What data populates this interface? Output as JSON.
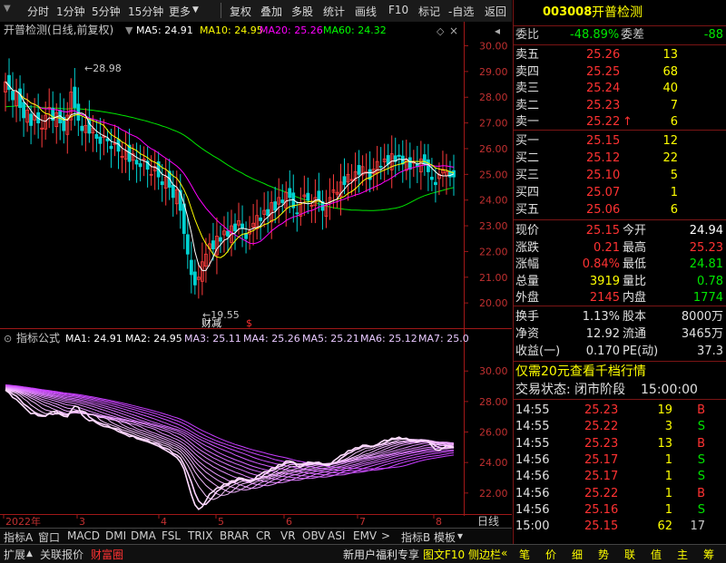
{
  "toolbar": {
    "items": [
      "分时",
      "1分钟",
      "5分钟",
      "15分钟",
      "更多",
      "复权",
      "叠加",
      "多股",
      "统计",
      "画线",
      "F10",
      "标记",
      "-自选",
      "返回"
    ]
  },
  "stock": {
    "code": "003008",
    "name": "开普检测"
  },
  "main_chart": {
    "title": "开普检测(日线,前复权)",
    "ma_labels": [
      {
        "text": "MA5: 24.91",
        "color": "#ffffff"
      },
      {
        "text": "MA10: 24.95",
        "color": "#ffff00"
      },
      {
        "text": "MA20: 25.26",
        "color": "#ff00ff"
      },
      {
        "text": "MA60: 24.32",
        "color": "#00ff00"
      }
    ],
    "high_annotation": "28.98",
    "low_annotation": "19.55",
    "marker_text": "财减",
    "marker_symbol": "$"
  },
  "indicator": {
    "title": "指标公式",
    "labels": [
      {
        "text": "MA1: 24.91",
        "color": "#ffffff"
      },
      {
        "text": "MA2: 24.95",
        "color": "#ffffff"
      },
      {
        "text": "MA3: 25.11",
        "color": "#e8c8ff"
      },
      {
        "text": "MA4: 25.26",
        "color": "#e8c8ff"
      },
      {
        "text": "MA5: 25.21",
        "color": "#e8c8ff"
      },
      {
        "text": "MA6: 25.12",
        "color": "#e8c8ff"
      },
      {
        "text": "MA7: 25.0",
        "color": "#e8c8ff"
      }
    ]
  },
  "chart_data": {
    "type": "candlestick",
    "price_axis": {
      "ticks": [
        "30.00",
        "29.00",
        "28.00",
        "27.00",
        "26.00",
        "25.00",
        "24.00",
        "23.00",
        "22.00",
        "21.00",
        "20.00"
      ],
      "ylim": [
        19.3,
        30.3
      ]
    },
    "indicator_axis": {
      "ticks": [
        "30.00",
        "28.00",
        "26.00",
        "24.00",
        "22.00"
      ],
      "ylim": [
        20.8,
        31.5
      ]
    },
    "x_labels": [
      "2022年",
      "3",
      "4",
      "5",
      "6",
      "7",
      "8"
    ],
    "x_label_positions": [
      0,
      27,
      57,
      78,
      103,
      130,
      158
    ],
    "period_label": "日线",
    "closes": [
      28.6,
      28.3,
      27.9,
      28.2,
      27.6,
      27.2,
      27.5,
      26.9,
      27.3,
      27.0,
      26.8,
      27.3,
      27.6,
      27.1,
      27.4,
      27.0,
      26.7,
      27.3,
      28.2,
      27.6,
      27.1,
      26.7,
      26.9,
      26.6,
      26.8,
      26.4,
      26.2,
      26.5,
      26.3,
      26.0,
      26.2,
      25.9,
      25.7,
      25.9,
      25.5,
      25.8,
      25.4,
      25.3,
      25.6,
      25.2,
      25.0,
      25.3,
      24.9,
      24.6,
      24.9,
      24.5,
      24.1,
      24.4,
      23.6,
      22.7,
      21.9,
      21.1,
      20.7,
      21.0,
      21.6,
      21.9,
      22.3,
      22.1,
      22.6,
      22.4,
      22.8,
      22.6,
      23.0,
      22.8,
      23.2,
      22.9,
      22.5,
      22.8,
      23.1,
      23.4,
      23.2,
      23.6,
      23.4,
      23.9,
      23.6,
      24.1,
      23.9,
      24.3,
      24.1,
      23.7,
      23.5,
      23.9,
      24.2,
      24.0,
      23.8,
      24.1,
      24.0,
      23.6,
      23.8,
      24.1,
      24.4,
      24.3,
      24.7,
      24.6,
      25.0,
      24.8,
      25.1,
      25.0,
      25.3,
      25.1,
      24.8,
      25.2,
      25.5,
      25.3,
      25.6,
      25.4,
      25.8,
      25.5,
      25.7,
      25.4,
      25.6,
      25.2,
      25.5,
      25.3,
      25.6,
      25.4,
      25.1,
      24.8,
      24.6,
      25.0,
      25.2,
      25.1,
      24.9,
      24.9
    ],
    "ma5_last": 24.91,
    "ma10_last": 24.95,
    "ma20_last": 25.26,
    "ma60_last": 24.32
  },
  "quote": {
    "weibi_label": "委比",
    "weibi": "-48.89%",
    "weicha_label": "委差",
    "weicha": "-88",
    "asks": [
      {
        "label": "卖五",
        "price": "25.26",
        "vol": "13",
        "arrow": ""
      },
      {
        "label": "卖四",
        "price": "25.25",
        "vol": "68",
        "arrow": ""
      },
      {
        "label": "卖三",
        "price": "25.24",
        "vol": "40",
        "arrow": ""
      },
      {
        "label": "卖二",
        "price": "25.23",
        "vol": "7",
        "arrow": ""
      },
      {
        "label": "卖一",
        "price": "25.22",
        "vol": "6",
        "arrow": "↑"
      }
    ],
    "bids": [
      {
        "label": "买一",
        "price": "25.15",
        "vol": "12"
      },
      {
        "label": "买二",
        "price": "25.12",
        "vol": "22"
      },
      {
        "label": "买三",
        "price": "25.10",
        "vol": "5"
      },
      {
        "label": "买四",
        "price": "25.07",
        "vol": "1"
      },
      {
        "label": "买五",
        "price": "25.06",
        "vol": "6"
      }
    ],
    "stats": [
      {
        "l1": "现价",
        "v1": "25.15",
        "c1": "red",
        "l2": "今开",
        "v2": "24.94",
        "c2": "white"
      },
      {
        "l1": "涨跌",
        "v1": "0.21",
        "c1": "red",
        "l2": "最高",
        "v2": "25.23",
        "c2": "red"
      },
      {
        "l1": "涨幅",
        "v1": "0.84%",
        "c1": "red",
        "l2": "最低",
        "v2": "24.81",
        "c2": "green"
      },
      {
        "l1": "总量",
        "v1": "3919",
        "c1": "yellow",
        "l2": "量比",
        "v2": "0.78",
        "c2": "green"
      },
      {
        "l1": "外盘",
        "v1": "2145",
        "c1": "red",
        "l2": "内盘",
        "v2": "1774",
        "c2": "green"
      }
    ],
    "fund": [
      {
        "l1": "换手",
        "v1": "1.13%",
        "l2": "股本",
        "v2": "8000万"
      },
      {
        "l1": "净资",
        "v1": "12.92",
        "l2": "流通",
        "v2": "3465万"
      },
      {
        "l1": "收益(一)",
        "v1": "0.170",
        "l2": "PE(动)",
        "v2": "37.3"
      }
    ],
    "promo": "仅需20元查看千档行情",
    "trade_status": "交易状态: 闭市阶段",
    "trade_time": "15:00:00",
    "ticks": [
      {
        "time": "14:55",
        "price": "25.23",
        "vol": "19",
        "side": "B"
      },
      {
        "time": "14:55",
        "price": "25.22",
        "vol": "3",
        "side": "S"
      },
      {
        "time": "14:55",
        "price": "25.23",
        "vol": "13",
        "side": "B"
      },
      {
        "time": "14:56",
        "price": "25.17",
        "vol": "1",
        "side": "S"
      },
      {
        "time": "14:56",
        "price": "25.17",
        "vol": "1",
        "side": "S"
      },
      {
        "time": "14:56",
        "price": "25.22",
        "vol": "1",
        "side": "B"
      },
      {
        "time": "14:56",
        "price": "25.16",
        "vol": "1",
        "side": "S"
      },
      {
        "time": "15:00",
        "price": "25.15",
        "vol": "62",
        "side": "17"
      }
    ]
  },
  "indicator_tabs": [
    "指标A",
    "窗口",
    "MACD",
    "DMI",
    "DMA",
    "FSL",
    "TRIX",
    "BRAR",
    "CR",
    "VR",
    "OBV",
    "ASI",
    "EMV",
    ">",
    "指标B",
    "模板"
  ],
  "status_left": [
    "扩展",
    "关联报价",
    "财富圈"
  ],
  "status_mid": [
    "新用户福利专享",
    "图文F10",
    "侧边栏"
  ],
  "status_right": [
    "笔",
    "价",
    "细",
    "势",
    "联",
    "值",
    "主",
    "筹"
  ]
}
